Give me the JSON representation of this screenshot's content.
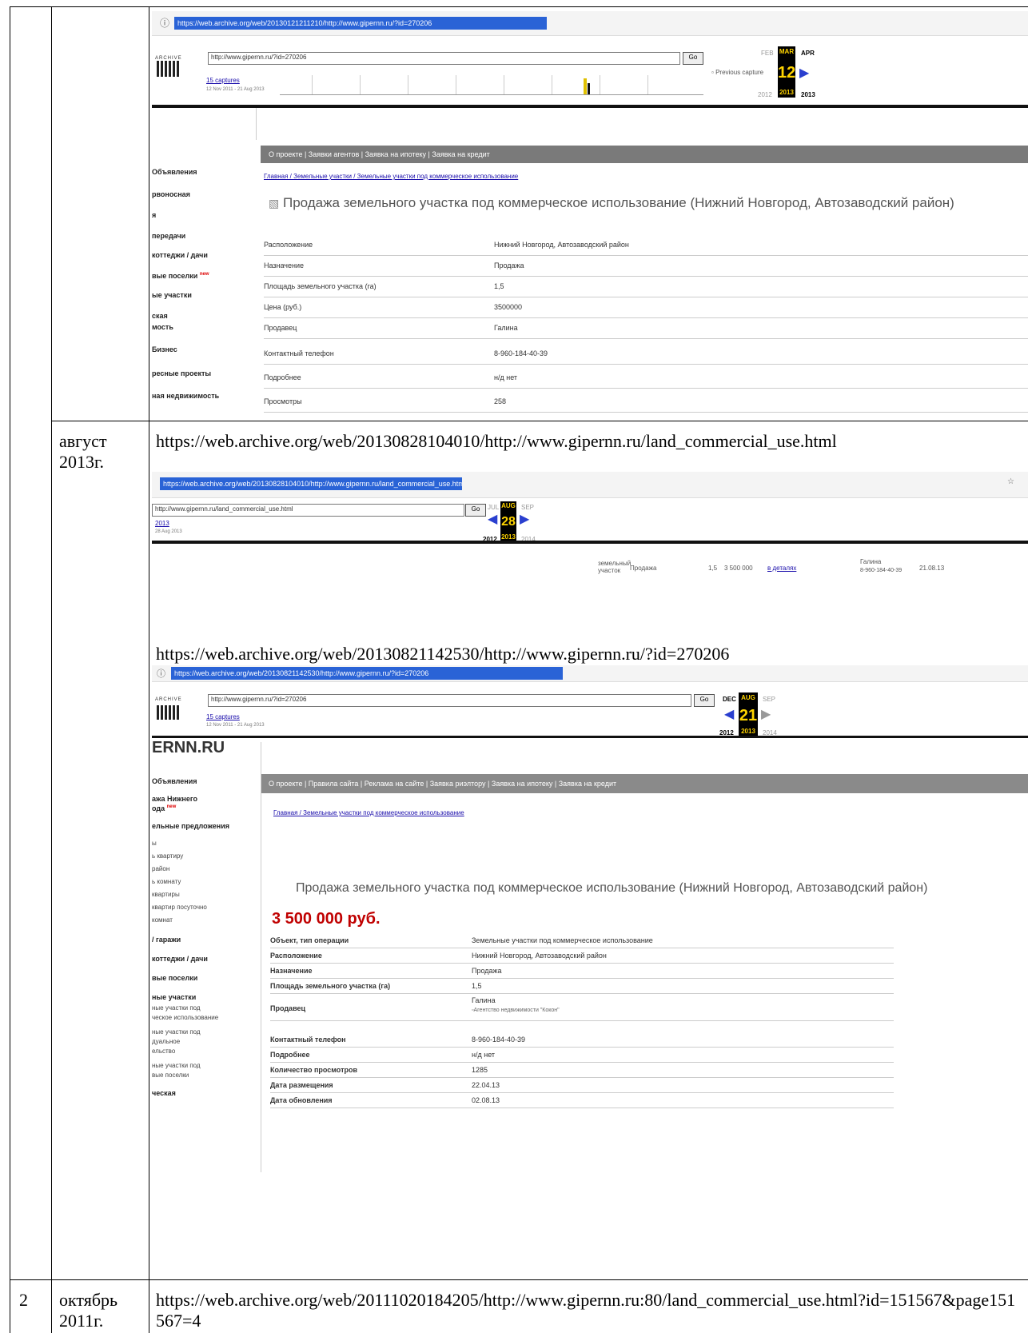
{
  "rows": [
    {
      "num": "",
      "date": "",
      "content": "screenshot-1"
    },
    {
      "num": "",
      "date": "август 2013г.",
      "url1": "https://web.archive.org/web/20130828104010/http://www.gipernn.ru/land_commercial_use.html",
      "url2": "https://web.archive.org/web/20130821142530/http://www.gipernn.ru/?id=270206"
    },
    {
      "num": "2",
      "date": "октябрь 2011г.",
      "url": "https://web.archive.org/web/20111020184205/http://www.gipernn.ru:80/land_commercial_use.html?id=151567&page151567=4"
    }
  ],
  "shot1": {
    "address": "https://web.archive.org/web/20130121211210/http://www.gipernn.ru/?id=270206",
    "wb_input": "http://www.gipernn.ru/?id=270206",
    "go": "Go",
    "captures": "15 captures",
    "captures_range": "12 Nov 2011 - 21 Aug 2013",
    "logo_caption": "ARCHIVE",
    "prev_capture": "Previous capture",
    "cal_prev": "FEB",
    "cal_cur": "MAR",
    "cal_next": "APR",
    "cal_day": "12",
    "year_prev": "2012",
    "year_cur": "2013",
    "year_next": "2013",
    "menu": "О проекте | Заявки агентов | Заявка на ипотеку | Заявка на кредит",
    "crumbs": "Главная / Земельные участки / Земельные участки под коммерческое использование",
    "title": "Продажа земельного участка под коммерческое использование (Нижний Новгород, Автозаводский район)",
    "sidebar": [
      "Объявления",
      "рвоносная",
      "я",
      "передачи",
      "коттеджи / дачи",
      "вые поселки",
      "ые участки",
      "ская",
      "мость",
      "Бизнес",
      "ресные проекты",
      "ная недвижимость"
    ],
    "sidebar_new": "new",
    "details": [
      [
        "Расположение",
        "Нижний Новгород, Автозаводский район"
      ],
      [
        "Назначение",
        "Продажа"
      ],
      [
        "Площадь земельного участка (га)",
        "1,5"
      ],
      [
        "Цена (руб.)",
        "3500000"
      ],
      [
        "Продавец",
        "Галина"
      ],
      [
        "Контактный телефон",
        "8-960-184-40-39"
      ],
      [
        "Подробнее",
        "н/д нет"
      ],
      [
        "Просмотры",
        "258"
      ]
    ]
  },
  "shot2": {
    "address": "https://web.archive.org/web/20130828104010/http://www.gipernn.ru/land_commercial_use.html",
    "wb_input": "http://www.gipernn.ru/land_commercial_use.html",
    "go": "Go",
    "captures": "2013",
    "captures_range": "28 Aug 2013",
    "cal_prev": "JUL",
    "cal_cur": "AUG",
    "cal_next": "SEP",
    "cal_day": "28",
    "year_prev": "2012",
    "year_cur": "2013",
    "year_next": "2014",
    "frag": [
      "земельный участок",
      "Продажа",
      "1,5",
      "3 500 000",
      "в деталях",
      "Галина",
      "8-960-184-40-39",
      "21.08.13"
    ]
  },
  "shot3": {
    "address": "https://web.archive.org/web/20130821142530/http://www.gipernn.ru/?id=270206",
    "wb_input": "http://www.gipernn.ru/?id=270206",
    "go": "Go",
    "captures": "15 captures",
    "captures_range": "12 Nov 2011 - 21 Aug 2013",
    "logo_caption": "ARCHIVE",
    "cal_prev": "DEC",
    "cal_cur": "AUG",
    "cal_next": "SEP",
    "cal_day": "21",
    "year_prev": "2012",
    "year_cur": "2013",
    "year_next": "2014",
    "site_logo": "ERNN.RU",
    "menu": "О проекте | Правила сайта | Реклама на сайте | Заявка риэлтору | Заявка на ипотеку | Заявка на кредит",
    "crumbs": "Главная / Земельные участки под коммерческое использование",
    "title": "Продажа земельного участка под коммерческое использование (Нижний Новгород, Автозаводский район)",
    "price": "3 500 000 руб.",
    "sidebar": [
      "Объявления",
      "ажа Нижнего",
      "ода",
      "ельные предложения",
      "ы",
      "ь квартиру",
      "район",
      "ь комнату",
      "квартиры",
      "квартир посуточно",
      "комнат",
      "/ гаражи",
      "коттеджи / дачи",
      "вые поселки",
      "ные участки",
      "ные участки под",
      "ческое использование",
      "ные участки под",
      "дуальное",
      "ельство",
      "ные участки под",
      "вые поселки",
      "ческая"
    ],
    "sidebar_new": "new",
    "details": [
      [
        "Объект, тип операции",
        "Земельные участки под коммерческое использование"
      ],
      [
        "Расположение",
        "Нижний Новгород, Автозаводский район"
      ],
      [
        "Назначение",
        "Продажа"
      ],
      [
        "Площадь земельного участка (га)",
        "1,5"
      ],
      [
        "Продавец",
        "Галина"
      ],
      [
        "Контактный телефон",
        "8-960-184-40-39"
      ],
      [
        "Подробнее",
        "н/д нет"
      ],
      [
        "Количество просмотров",
        "1285"
      ],
      [
        "Дата размещения",
        "22.04.13"
      ],
      [
        "Дата обновления",
        "02.08.13"
      ]
    ],
    "seller_agency": "Агентство недвижимости \"Кокон\""
  }
}
